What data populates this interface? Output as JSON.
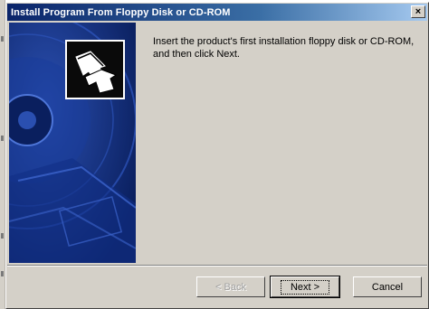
{
  "window": {
    "title": "Install Program From Floppy Disk or CD-ROM",
    "close_glyph": "×"
  },
  "wizard": {
    "instruction": "Insert the product's first installation floppy disk or CD-ROM, and then click Next.",
    "art_icon": "install-arrow-icon"
  },
  "buttons": {
    "back_label": "< Back",
    "next_label": "Next >",
    "cancel_label": "Cancel"
  },
  "colors": {
    "title_start": "#0a246a",
    "title_end": "#a6caf0",
    "art_background": "#0c2a78",
    "dialog_face": "#d4d0c8"
  }
}
